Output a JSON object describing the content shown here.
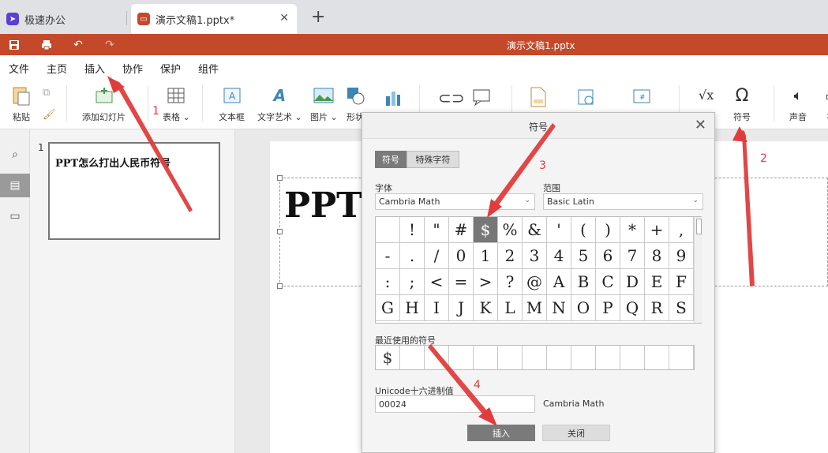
{
  "tabs": {
    "app_tab": "极速办公",
    "doc_tab": "演示文稿1.pptx*",
    "new_tab": "+"
  },
  "titlebar": {
    "title": "演示文稿1.pptx"
  },
  "menu": [
    "文件",
    "主页",
    "插入",
    "协作",
    "保护",
    "组件"
  ],
  "ribbon": {
    "paste": "粘贴",
    "add_slide": "添加幻灯片",
    "table": "表格",
    "textbox": "文本框",
    "wordart": "文字艺术",
    "picture": "图片",
    "shape": "形状",
    "symbol": "符号",
    "audio": "声音",
    "video": "视"
  },
  "thumbnail": {
    "number": "1",
    "title": "PPT怎么打出人民币符号"
  },
  "slide": {
    "title": "PPT怎"
  },
  "dialog": {
    "title": "符号",
    "tab_symbol": "符号",
    "tab_special": "特殊字符",
    "font_label": "字体",
    "font_value": "Cambria Math",
    "range_label": "范围",
    "range_value": "Basic Latin",
    "symbols": [
      " ",
      "!",
      "\"",
      "#",
      "$",
      "%",
      "&",
      "'",
      "(",
      ")",
      "*",
      "+",
      ",",
      "-",
      ".",
      "/",
      "0",
      "1",
      "2",
      "3",
      "4",
      "5",
      "6",
      "7",
      "8",
      "9",
      ":",
      ";",
      "<",
      "=",
      ">",
      "?",
      "@",
      "A",
      "B",
      "C",
      "D",
      "E",
      "F",
      "G",
      "H",
      "I",
      "J",
      "K",
      "L",
      "M",
      "N",
      "O",
      "P",
      "Q",
      "R",
      "S"
    ],
    "selected_symbol": "$",
    "recent_label": "最近使用的符号",
    "recent": [
      "$"
    ],
    "unicode_label": "Unicode十六进制值",
    "unicode_value": "00024",
    "unicode_font": "Cambria Math",
    "insert_button": "插入",
    "close_button": "关闭"
  },
  "annotations": [
    "1",
    "2",
    "3",
    "4"
  ],
  "colors": {
    "accent": "#c4492b",
    "annotation": "#e03c3c",
    "selected": "#777777"
  }
}
